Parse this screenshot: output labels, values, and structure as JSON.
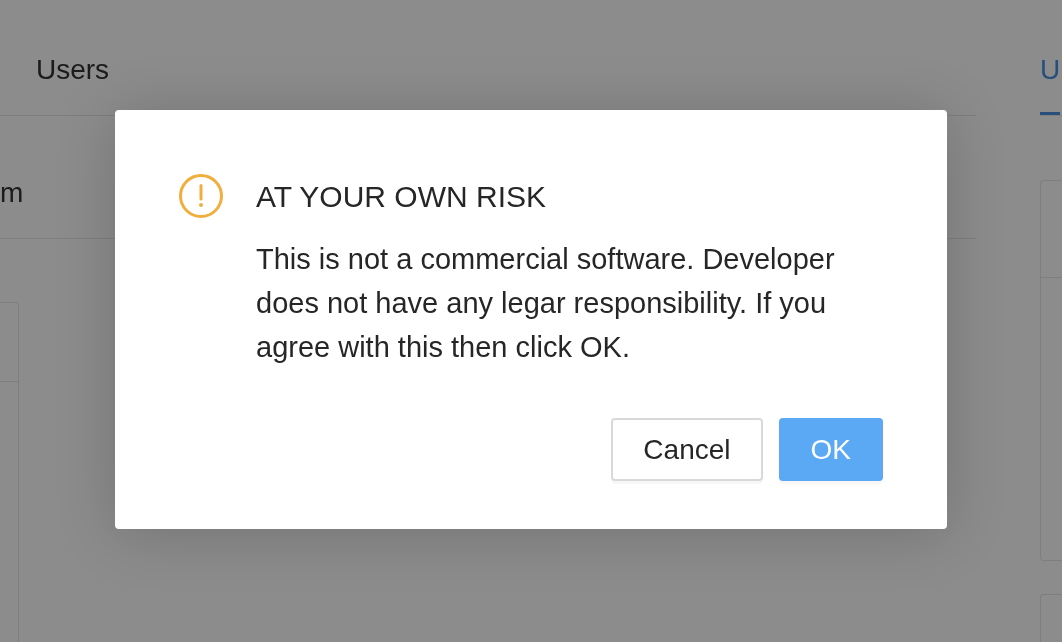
{
  "app": {
    "left_pane": {
      "tabs": [
        {
          "label": "Users",
          "selected": false
        }
      ],
      "row_label": "m"
    },
    "right_pane": {
      "tabs": [
        {
          "label": "U",
          "selected": true
        }
      ]
    }
  },
  "dialog": {
    "title": "AT YOUR OWN RISK",
    "message": "This is not a commercial software. Developer does not have any legar responsibility. If you agree with this then click OK.",
    "buttons": [
      {
        "label": "Cancel",
        "kind": "default"
      },
      {
        "label": "OK",
        "kind": "primary"
      }
    ]
  }
}
